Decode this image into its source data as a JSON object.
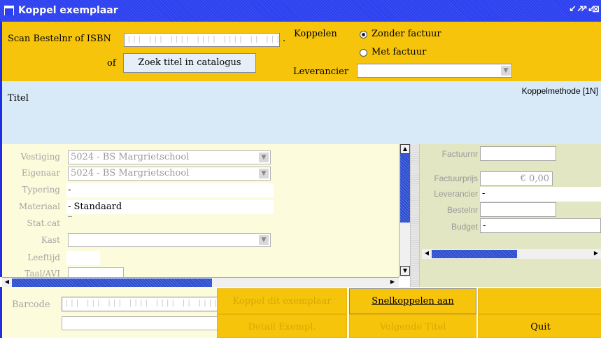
{
  "window": {
    "title": "Koppel exemplaar",
    "controls": [
      "↙↗",
      "↗↙",
      "⊠"
    ]
  },
  "scan": {
    "label": "Scan Bestelnr of ISBN",
    "placeholder": "||| ||| |||| |||| |||| || |||| ||| || ||| |||",
    "dot": ".",
    "of_label": "of",
    "catalog_button": "Zoek titel in catalogus"
  },
  "koppelen": {
    "label": "Koppelen",
    "options": [
      {
        "label": "Zonder factuur",
        "selected": true
      },
      {
        "label": "Met factuur",
        "selected": false
      }
    ],
    "leverancier_label": "Leverancier",
    "leverancier_value": ""
  },
  "title_area": {
    "label": "Titel",
    "method": "Koppelmethode [1N]"
  },
  "fields": {
    "vestiging": {
      "label": "Vestiging",
      "value": "5024 - BS Margrietschool"
    },
    "eigenaar": {
      "label": "Eigenaar",
      "value": "5024 - BS Margrietschool"
    },
    "typering": {
      "label": "Typering",
      "value": "-"
    },
    "materiaal": {
      "label": "Materiaal",
      "value": "- Standaard"
    },
    "statcat": {
      "label": "Stat.cat",
      "value": ""
    },
    "kast": {
      "label": "Kast",
      "value": ""
    },
    "leeftijd": {
      "label": "Leeftijd",
      "value": ""
    },
    "taal": {
      "label": "Taal/AVI",
      "value": ""
    }
  },
  "invoice": {
    "factuurnr": {
      "label": "Factuurnr",
      "value": ""
    },
    "factuurprijs": {
      "label": "Factuurprijs",
      "value": "€ 0,00"
    },
    "leverancier": {
      "label": "Leverancier",
      "value": "-"
    },
    "bestelnr": {
      "label": "Bestelnr",
      "value": ""
    },
    "budget": {
      "label": "Budget",
      "value": "-"
    }
  },
  "bottom": {
    "barcode_label": "Barcode",
    "barcode_placeholder": "||| ||| ||| |||| |||| || |||| ||| || ||| |||",
    "barcode_dot": ".",
    "buttons": {
      "koppel": "Koppel dit exemplaar",
      "snel": "Snelkoppelen aan",
      "detail": "Detail Exempl.",
      "volgende": "Volgende Titel",
      "quit": "Quit"
    }
  },
  "colors": {
    "titlebar": "#2b3ff0",
    "accent_yellow": "#f7c40c",
    "title_panel": "#d8e9f8",
    "form_bg": "#fcfbdc",
    "invoice_bg": "#e3e6c2"
  }
}
